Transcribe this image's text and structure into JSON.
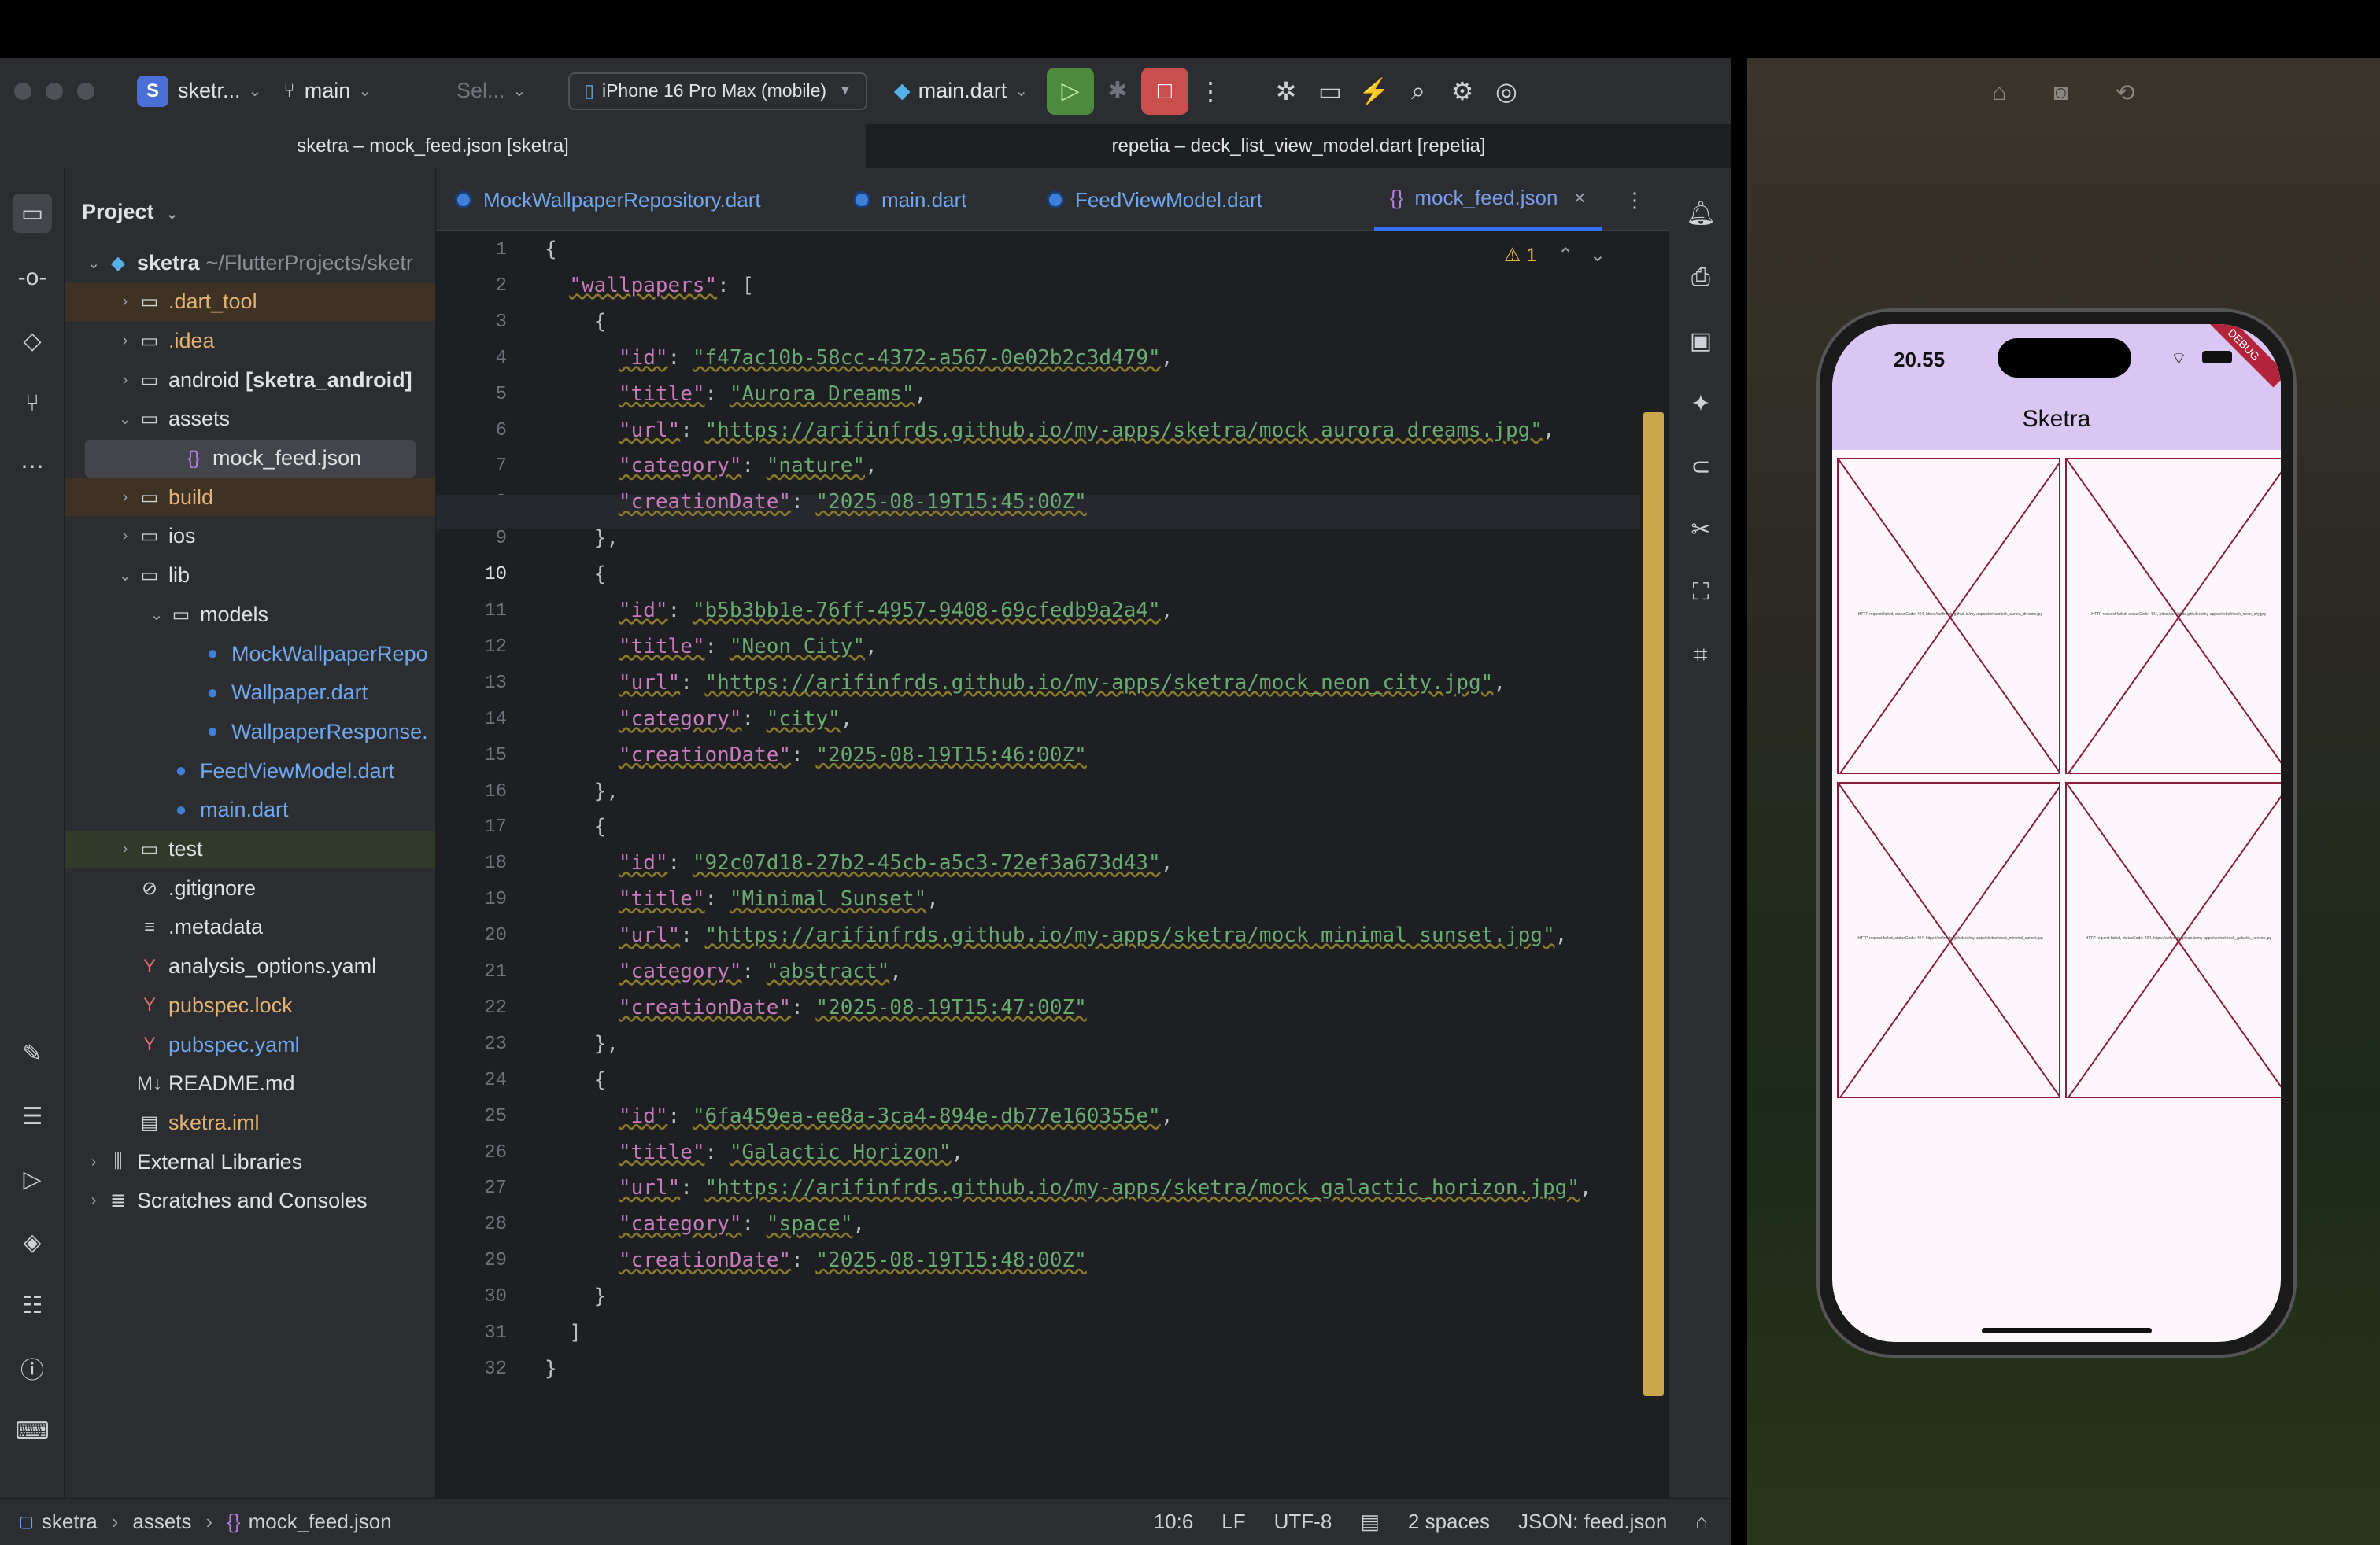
{
  "toolbar": {
    "project_badge": "S",
    "project_name": "sketr...",
    "branch": "main",
    "config": "Sel...",
    "device": "iPhone 16 Pro Max (mobile)",
    "run_config": "main.dart"
  },
  "project_tabs": [
    "sketra – mock_feed.json [sketra]",
    "repetia – deck_list_view_model.dart [repetia]"
  ],
  "project_panel": {
    "title": "Project",
    "items": [
      {
        "label": "sketra",
        "suffix": "~/FlutterProjects/sketr",
        "depth": 0,
        "arrow": "open",
        "icon": "flutter-icon",
        "bold": true
      },
      {
        "label": ".dart_tool",
        "depth": 1,
        "arrow": "closed",
        "icon": "folder-icon",
        "hl": "brown",
        "color": "#e3b375"
      },
      {
        "label": ".idea",
        "depth": 1,
        "arrow": "closed",
        "icon": "folder-icon",
        "color": "#e3b375"
      },
      {
        "label": "android",
        "suffix": "[sketra_android]",
        "depth": 1,
        "arrow": "closed",
        "icon": "folder-icon",
        "suffix_bold": true
      },
      {
        "label": "assets",
        "depth": 1,
        "arrow": "open",
        "icon": "folder-icon"
      },
      {
        "label": "mock_feed.json",
        "depth": 2,
        "arrow": "none",
        "icon": "json-icon",
        "hl": "sel"
      },
      {
        "label": "build",
        "depth": 1,
        "arrow": "closed",
        "icon": "folder-icon",
        "hl": "brown",
        "color": "#e3b375"
      },
      {
        "label": "ios",
        "depth": 1,
        "arrow": "closed",
        "icon": "folder-icon"
      },
      {
        "label": "lib",
        "depth": 1,
        "arrow": "open",
        "icon": "folder-icon"
      },
      {
        "label": "models",
        "depth": 2,
        "arrow": "open",
        "icon": "folder-icon"
      },
      {
        "label": "MockWallpaperRepo",
        "depth": 3,
        "arrow": "none",
        "icon": "dart-icon",
        "color": "#6fa8ee"
      },
      {
        "label": "Wallpaper.dart",
        "depth": 3,
        "arrow": "none",
        "icon": "dart-icon",
        "color": "#6fa8ee"
      },
      {
        "label": "WallpaperResponse.",
        "depth": 3,
        "arrow": "none",
        "icon": "dart-icon",
        "color": "#6fa8ee"
      },
      {
        "label": "FeedViewModel.dart",
        "depth": 2,
        "arrow": "none",
        "icon": "dart-icon",
        "color": "#6fa8ee"
      },
      {
        "label": "main.dart",
        "depth": 2,
        "arrow": "none",
        "icon": "dart-icon",
        "color": "#6fa8ee"
      },
      {
        "label": "test",
        "depth": 1,
        "arrow": "closed",
        "icon": "folder-icon",
        "hl": "green"
      },
      {
        "label": ".gitignore",
        "depth": 1,
        "arrow": "none",
        "icon": "ignore-icon"
      },
      {
        "label": ".metadata",
        "depth": 1,
        "arrow": "none",
        "icon": "text-icon"
      },
      {
        "label": "analysis_options.yaml",
        "depth": 1,
        "arrow": "none",
        "icon": "yaml-icon"
      },
      {
        "label": "pubspec.lock",
        "depth": 1,
        "arrow": "none",
        "icon": "yaml-icon",
        "color": "#e3b375"
      },
      {
        "label": "pubspec.yaml",
        "depth": 1,
        "arrow": "none",
        "icon": "yaml-icon",
        "color": "#6fa8ee"
      },
      {
        "label": "README.md",
        "depth": 1,
        "arrow": "none",
        "icon": "markdown-icon"
      },
      {
        "label": "sketra.iml",
        "depth": 1,
        "arrow": "none",
        "icon": "iml-icon",
        "color": "#e3b375"
      },
      {
        "label": "External Libraries",
        "depth": 0,
        "arrow": "closed",
        "icon": "library-icon"
      },
      {
        "label": "Scratches and Consoles",
        "depth": 0,
        "arrow": "closed",
        "icon": "scratch-icon"
      }
    ]
  },
  "editor_tabs": [
    "MockWallpaperRepository.dart",
    "main.dart",
    "FeedViewModel.dart",
    "mock_feed.json"
  ],
  "warnings": "1",
  "code_lines": [
    "{",
    "  \"wallpapers\": [",
    "    {",
    "      \"id\": \"f47ac10b-58cc-4372-a567-0e02b2c3d479\",",
    "      \"title\": \"Aurora Dreams\",",
    "      \"url\": \"https://arifinfrds.github.io/my-apps/sketra/mock_aurora_dreams.jpg\",",
    "      \"category\": \"nature\",",
    "      \"creationDate\": \"2025-08-19T15:45:00Z\"",
    "    },",
    "    {",
    "      \"id\": \"b5b3bb1e-76ff-4957-9408-69cfedb9a2a4\",",
    "      \"title\": \"Neon City\",",
    "      \"url\": \"https://arifinfrds.github.io/my-apps/sketra/mock_neon_city.jpg\",",
    "      \"category\": \"city\",",
    "      \"creationDate\": \"2025-08-19T15:46:00Z\"",
    "    },",
    "    {",
    "      \"id\": \"92c07d18-27b2-45cb-a5c3-72ef3a673d43\",",
    "      \"title\": \"Minimal Sunset\",",
    "      \"url\": \"https://arifinfrds.github.io/my-apps/sketra/mock_minimal_sunset.jpg\",",
    "      \"category\": \"abstract\",",
    "      \"creationDate\": \"2025-08-19T15:47:00Z\"",
    "    },",
    "    {",
    "      \"id\": \"6fa459ea-ee8a-3ca4-894e-db77e160355e\",",
    "      \"title\": \"Galactic Horizon\",",
    "      \"url\": \"https://arifinfrds.github.io/my-apps/sketra/mock_galactic_horizon.jpg\",",
    "      \"category\": \"space\",",
    "      \"creationDate\": \"2025-08-19T15:48:00Z\"",
    "    }",
    "  ]",
    "}"
  ],
  "statusbar": {
    "breadcrumb": [
      "sketra",
      "assets",
      "mock_feed.json"
    ],
    "position": "10:6",
    "line_sep": "LF",
    "encoding": "UTF-8",
    "indent": "2 spaces",
    "schema": "JSON: feed.json"
  },
  "phone": {
    "time": "20.55",
    "app_title": "Sketra",
    "debug_banner": "DEBUG",
    "tile_errors": [
      "HTTP request failed, statusCode: 404, https://arifinfrds.github.io/my-apps/sketra/mock_aurora_dreams.jpg",
      "HTTP request failed, statusCode: 404, https://arifinfrds.github.io/my-apps/sketra/mock_neon_city.jpg",
      "HTTP request failed, statusCode: 404, https://arifinfrds.github.io/my-apps/sketra/mock_minimal_sunset.jpg",
      "HTTP request failed, statusCode: 404, https://arifinfrds.github.io/my-apps/sketra/mock_galactic_horizon.jpg"
    ]
  },
  "colors": {
    "appbar": "#d9c6f2",
    "tile_border": "#8a1d3a",
    "accent": "#3574f0"
  }
}
